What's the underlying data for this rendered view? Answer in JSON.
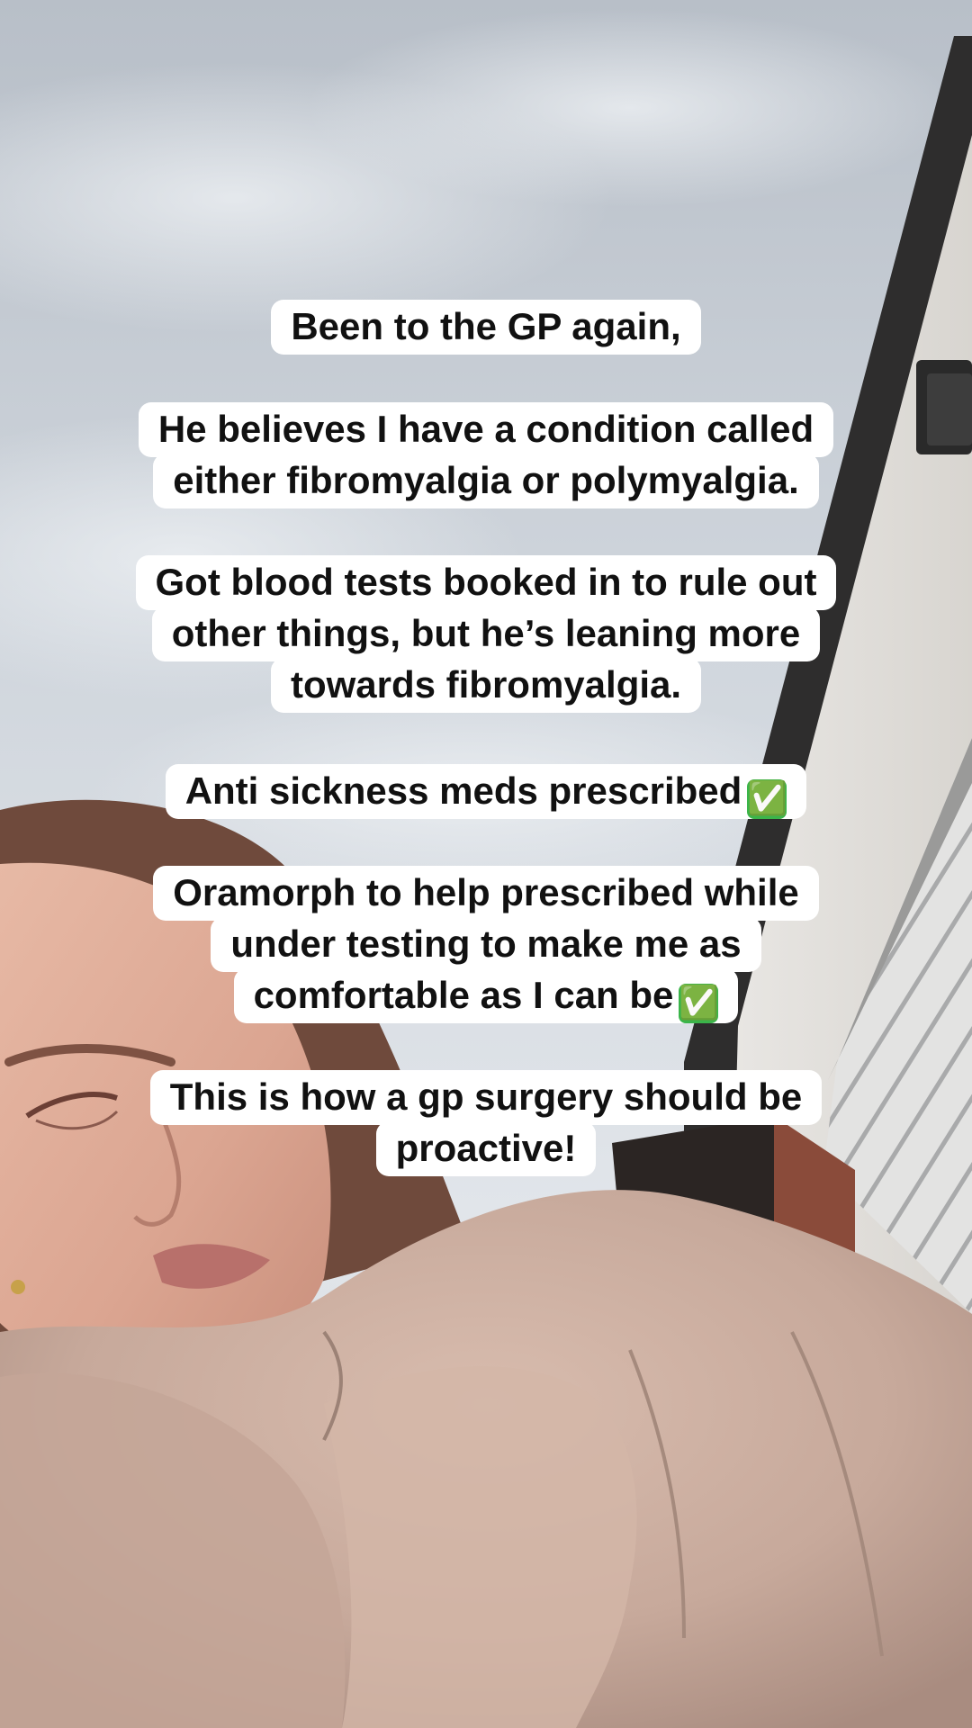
{
  "captions": [
    {
      "lines": [
        "Been to the GP again,"
      ]
    },
    {
      "lines": [
        "He believes I have a condition called",
        "either fibromyalgia or polymyalgia."
      ]
    },
    {
      "lines": [
        "Got blood tests booked in to rule out",
        "other things, but he’s leaning more",
        "towards fibromyalgia."
      ]
    },
    {
      "lines": [
        "Anti sickness meds prescribed"
      ],
      "emoji": "✅"
    },
    {
      "lines": [
        "Oramorph to help prescribed while",
        "under testing to make me as",
        "comfortable as I can be"
      ],
      "emoji": "✅"
    },
    {
      "lines": [
        "This is how a gp surgery should be",
        "proactive!"
      ]
    }
  ],
  "icons": {
    "check": "check-mark-button-icon"
  },
  "colors": {
    "caption_bg": "#ffffff",
    "caption_text": "#111111",
    "check_green": "#3bb54a",
    "sky": "#c9cfd6",
    "jacket": "#c9ad9f"
  }
}
